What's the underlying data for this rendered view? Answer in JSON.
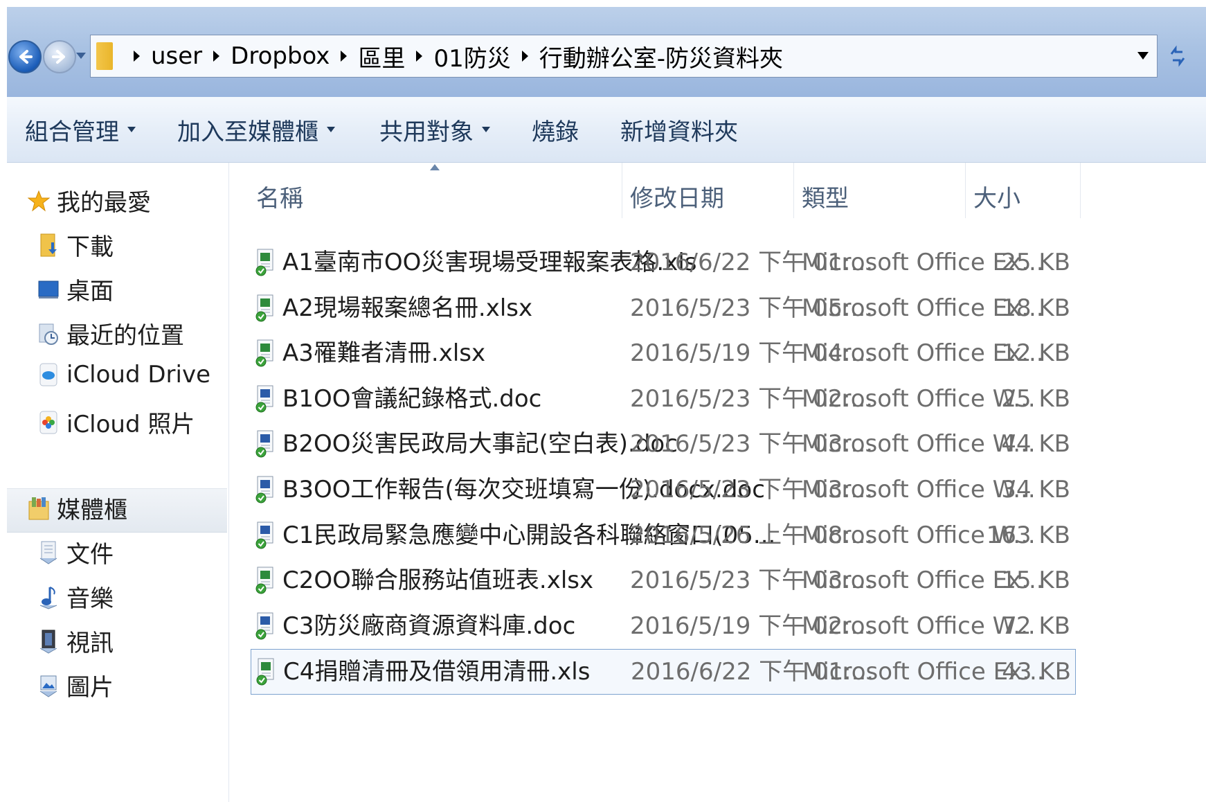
{
  "address_bar": {
    "breadcrumbs": [
      "user",
      "Dropbox",
      "區里",
      "01防災",
      "行動辦公室-防災資料夾"
    ]
  },
  "toolbar": {
    "organize": "組合管理",
    "add_to_library": "加入至媒體櫃",
    "share_with": "共用對象",
    "burn": "燒錄",
    "new_folder": "新增資料夾"
  },
  "nav": {
    "favorites": "我的最愛",
    "downloads": "下載",
    "desktop": "桌面",
    "recent": "最近的位置",
    "icloud_drive": "iCloud Drive",
    "icloud_photos": "iCloud 照片",
    "libraries": "媒體櫃",
    "documents": "文件",
    "music": "音樂",
    "videos": "視訊",
    "pictures": "圖片"
  },
  "columns": {
    "name": "名稱",
    "date": "修改日期",
    "type": "類型",
    "size": "大小"
  },
  "files": [
    {
      "name": "A1臺南市OO災害現場受理報案表格.xls",
      "date": "2016/6/22 下午 01:...",
      "type": "Microsoft Office Ex...",
      "size": "25 KB",
      "icon": "excel-file-icon"
    },
    {
      "name": "A2現場報案總名冊.xlsx",
      "date": "2016/5/23 下午 05:...",
      "type": "Microsoft Office Ex...",
      "size": "18 KB",
      "icon": "excel-file-icon"
    },
    {
      "name": "A3罹難者清冊.xlsx",
      "date": "2016/5/19 下午 04:...",
      "type": "Microsoft Office Ex...",
      "size": "12 KB",
      "icon": "excel-file-icon"
    },
    {
      "name": "B1OO會議紀錄格式.doc",
      "date": "2016/5/23 下午 02:...",
      "type": "Microsoft Office W...",
      "size": "25 KB",
      "icon": "word-file-icon"
    },
    {
      "name": "B2OO災害民政局大事記(空白表).doc",
      "date": "2016/5/23 下午 03:...",
      "type": "Microsoft Office W...",
      "size": "44 KB",
      "icon": "word-file-icon"
    },
    {
      "name": "B3OO工作報告(每次交班填寫一份).docx.doc",
      "date": "2016/5/23 下午 03:...",
      "type": "Microsoft Office W...",
      "size": "34 KB",
      "icon": "word-file-icon"
    },
    {
      "name": "C1民政局緊急應變中心開設各科聯絡窗口(05...",
      "date": "2016/5/26 上午 08:...",
      "type": "Microsoft Office W...",
      "size": "163 KB",
      "icon": "word-file-icon"
    },
    {
      "name": "C2OO聯合服務站值班表.xlsx",
      "date": "2016/5/23 下午 03:...",
      "type": "Microsoft Office Ex...",
      "size": "15 KB",
      "icon": "excel-file-icon"
    },
    {
      "name": "C3防災廠商資源資料庫.doc",
      "date": "2016/5/19 下午 02:...",
      "type": "Microsoft Office W...",
      "size": "72 KB",
      "icon": "word-file-icon"
    },
    {
      "name": "C4捐贈清冊及借領用清冊.xls",
      "date": "2016/6/22 下午 01:...",
      "type": "Microsoft Office Ex...",
      "size": "43 KB",
      "icon": "excel-file-icon"
    }
  ],
  "colors": {
    "title_bar": "#a9c2e3",
    "toolbar_text": "#1e395b",
    "selection_border": "#7da2ce",
    "excel_green": "#2e8b3c",
    "word_blue": "#2b5ba8",
    "sync_check": "#3ba33b"
  }
}
